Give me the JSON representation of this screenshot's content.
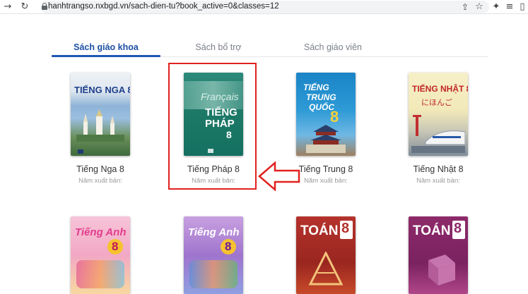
{
  "browser": {
    "url": "hanhtrangso.nxbgd.vn/sach-dien-tu?book_active=0&classes=12",
    "icons": [
      "back-arrow-icon",
      "reload-icon",
      "lock-icon",
      "share-icon",
      "star-icon",
      "extensions-icon",
      "media-icon",
      "profile-icon"
    ]
  },
  "tabs": [
    {
      "label": "Sách giáo khoa",
      "active": true
    },
    {
      "label": "Sách bổ trợ",
      "active": false
    },
    {
      "label": "Sách giáo viên",
      "active": false
    }
  ],
  "books_row1": [
    {
      "title": "Tiếng Nga 8",
      "year_label": "Năm xuất bản:",
      "cover_text": "TIẾNG NGA 8"
    },
    {
      "title": "Tiếng Pháp 8",
      "year_label": "Năm xuất bản:",
      "cover_text_top": "Français",
      "cover_text_main": "TIẾNG",
      "cover_text_main2": "PHÁP",
      "cover_num": "8"
    },
    {
      "title": "Tiếng Trung 8",
      "year_label": "Năm xuất bản:",
      "cover_text_1": "TIẾNG",
      "cover_text_2": "TRUNG",
      "cover_text_3": "QUỐC",
      "cover_num": "8"
    },
    {
      "title": "Tiếng Nhật 8",
      "year_label": "Năm xuất bản:",
      "cover_text": "TIẾNG NHẬT 8",
      "cover_kana": "にほんご"
    }
  ],
  "books_row2": [
    {
      "cover_text": "Tiếng Anh",
      "cover_num": "8"
    },
    {
      "cover_text": "Tiếng Anh",
      "cover_num": "8"
    },
    {
      "cover_text": "TOÁN",
      "cover_num": "8"
    },
    {
      "cover_text": "TOÁN",
      "cover_num": "8"
    }
  ],
  "colors": {
    "accent": "#1f56b5",
    "highlight": "#e0221f"
  }
}
